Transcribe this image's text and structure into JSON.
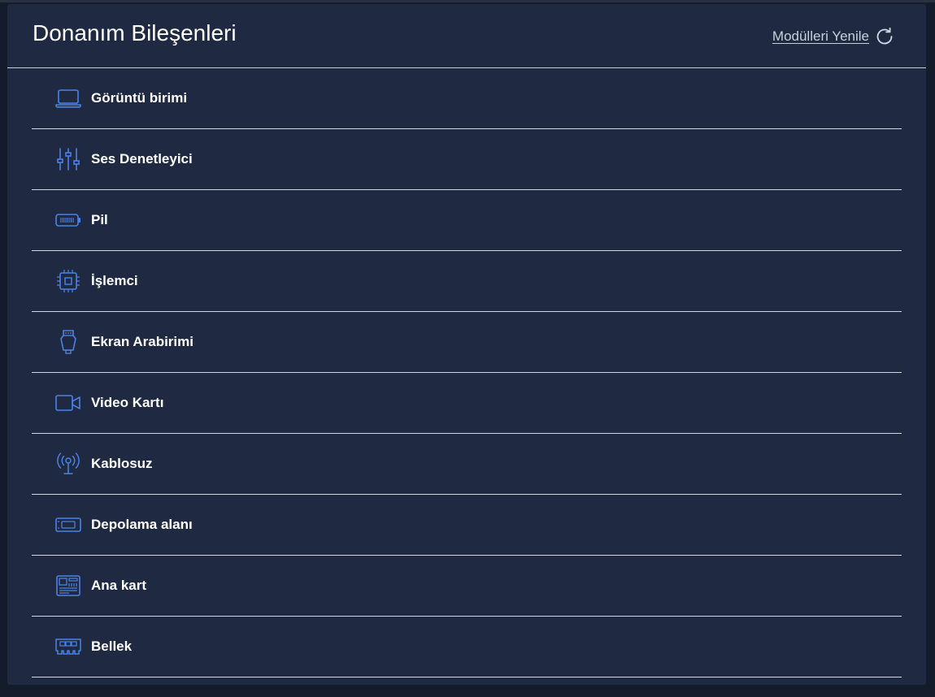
{
  "header": {
    "title": "Donanım Bileşenleri",
    "refresh_label": "Modülleri Yenile",
    "refresh_icon": "refresh-icon"
  },
  "colors": {
    "panel_bg": "#1f2a42",
    "page_bg": "#141c2c",
    "icon_accent": "#4a82e6",
    "text": "#ffffff"
  },
  "items": [
    {
      "label": "Görüntü birimi",
      "icon": "laptop-icon"
    },
    {
      "label": "Ses Denetleyici",
      "icon": "sliders-icon"
    },
    {
      "label": "Pil",
      "icon": "battery-icon"
    },
    {
      "label": "İşlemci",
      "icon": "cpu-icon"
    },
    {
      "label": "Ekran Arabirimi",
      "icon": "display-connector-icon"
    },
    {
      "label": "Video Kartı",
      "icon": "video-camera-icon"
    },
    {
      "label": "Kablosuz",
      "icon": "wireless-antenna-icon"
    },
    {
      "label": "Depolama alanı",
      "icon": "storage-drive-icon"
    },
    {
      "label": "Ana kart",
      "icon": "motherboard-icon"
    },
    {
      "label": "Bellek",
      "icon": "memory-icon"
    }
  ]
}
